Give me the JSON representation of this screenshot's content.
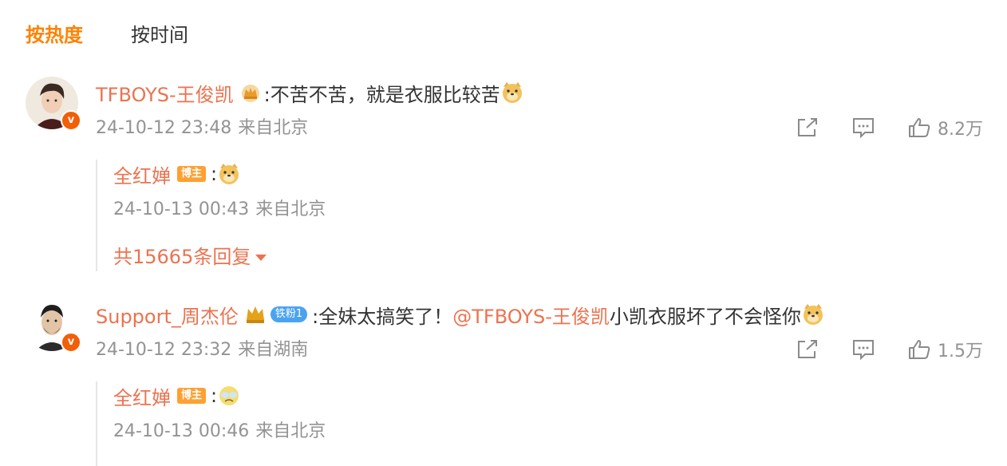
{
  "sort_tabs": [
    {
      "label": "按热度",
      "active": true
    },
    {
      "label": "按时间",
      "active": false
    }
  ],
  "colors": {
    "accent": "#ff8200",
    "username": "#eb7350",
    "meta": "#939393",
    "verified": "#f15f08",
    "host_badge": "#ffa033"
  },
  "comments": [
    {
      "username": "TFBOYS-王俊凯",
      "user_icons": [
        "crown-icon"
      ],
      "text": ":不苦不苦，就是衣服比较苦",
      "emoji": "doge-emoji",
      "date": "24-10-12 23:48",
      "location": "来自北京",
      "likes": "8.2万",
      "reply": {
        "username": "全红婵",
        "badge": "博主",
        "text": ":",
        "emoji": "doge-emoji",
        "date": "24-10-13 00:43",
        "location": "来自北京"
      },
      "more_replies": "共15665条回复"
    },
    {
      "username": "Support_周杰伦",
      "user_icons": [
        "crown-icon"
      ],
      "fan_badge": "铁粉1",
      "text_before": ":全妹太搞笑了！",
      "mention": "@TFBOYS-王俊凯",
      "text_after": " 小凯衣服坏了不会怪你",
      "emoji": "doge-emoji",
      "date": "24-10-12 23:32",
      "location": "来自湖南",
      "likes": "1.5万",
      "reply": {
        "username": "全红婵",
        "badge": "博主",
        "text": ":",
        "emoji": "tearful-emoji",
        "date": "24-10-13 00:46",
        "location": "来自北京"
      }
    }
  ]
}
